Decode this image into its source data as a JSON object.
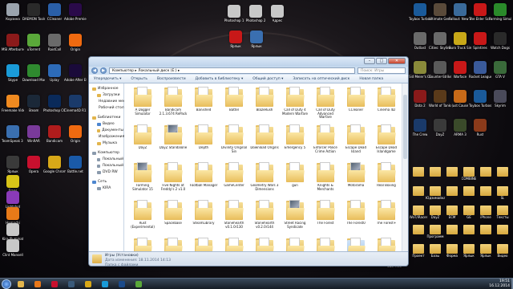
{
  "desktop": {
    "left_icons": [
      {
        "label": "Корзина",
        "color": "#9aa3ad",
        "icon": "recycle-bin-icon"
      },
      {
        "label": "MSI Afterburner",
        "color": "#8b1a1a",
        "icon": "afterburner-icon"
      },
      {
        "label": "Skype",
        "color": "#1a9bd8",
        "icon": "skype-icon"
      },
      {
        "label": "Freemake Video Conv...",
        "color": "#f08a20",
        "icon": "freemake-icon"
      },
      {
        "label": "TeamSpeak 3 Client",
        "color": "#3a6fb0",
        "icon": "teamspeak-icon"
      },
      {
        "label": "Ярлык",
        "color": "#3a3a3a",
        "icon": "shortcut-icon"
      },
      {
        "label": "DAEMON Tools Ultra",
        "color": "#2a2a2a",
        "icon": "daemon-tools-icon"
      },
      {
        "label": "uTorrent",
        "color": "#5aa83a",
        "icon": "utorrent-icon"
      },
      {
        "label": "Download Master",
        "color": "#2f8a2f",
        "icon": "download-master-icon"
      },
      {
        "label": "Steam",
        "color": "#1b2838",
        "icon": "steam-icon"
      },
      {
        "label": "WinRAR",
        "color": "#7a3a9a",
        "icon": "winrar-icon"
      },
      {
        "label": "Opera",
        "color": "#c8102e",
        "icon": "opera-icon"
      },
      {
        "label": "CCleaner",
        "color": "#2a5fa8",
        "icon": "ccleaner-icon"
      },
      {
        "label": "RaidCall",
        "color": "#6a6a6a",
        "icon": "raidcall-icon"
      },
      {
        "label": "Uplay",
        "color": "#2d6bb8",
        "icon": "uplay-icon"
      },
      {
        "label": "Photoshop CC x64",
        "color": "#0a2a5a",
        "icon": "photoshop-icon"
      },
      {
        "label": "Bandicam",
        "color": "#b01c1c",
        "icon": "bandicam-icon"
      },
      {
        "label": "Google Chrome",
        "color": "#d8a818",
        "icon": "chrome-icon"
      },
      {
        "label": "Adobe Premiere CC x64",
        "color": "#2a0a4a",
        "icon": "premiere-icon"
      },
      {
        "label": "Origin",
        "color": "#f06a10",
        "icon": "origin-icon"
      },
      {
        "label": "Adobe After Effects CC",
        "color": "#1a0a3a",
        "icon": "after-effects-icon"
      },
      {
        "label": "Cinema4D R15",
        "color": "#1a3a6a",
        "icon": "cinema4d-icon"
      },
      {
        "label": "Origin",
        "color": "#f06a10",
        "icon": "origin-icon"
      },
      {
        "label": "Battle.net",
        "color": "#1a5aa8",
        "icon": "battlenet-icon"
      },
      {
        "label": "Fraps",
        "color": "#d8c418",
        "icon": "fraps-icon"
      },
      {
        "label": "Lightshot",
        "color": "#8a3ab8",
        "icon": "lightshot-icon"
      },
      {
        "label": "Hamachi",
        "color": "#e87a18",
        "icon": "hamachi-icon"
      },
      {
        "label": "Kira Illuminat",
        "color": "#c8c8c8",
        "icon": "file-icon"
      },
      {
        "label": "Clint Mansell",
        "color": "#c8c8c8",
        "icon": "file-icon"
      }
    ],
    "top_icons": [
      {
        "label": "Photoshop 1",
        "color": "#c8c8c8"
      },
      {
        "label": "Photoshop 2",
        "color": "#c8c8c8"
      },
      {
        "label": "Адрес",
        "color": "#c8c8c8"
      },
      {
        "label": "Ярлык",
        "color": "#c81818"
      },
      {
        "label": "Ярлык",
        "color": "#3a6fb0"
      }
    ],
    "right_icons": [
      {
        "label": "Toybox Turbos",
        "color": "#1a5a9a"
      },
      {
        "label": "Ultimate General",
        "color": "#5a4a3a"
      },
      {
        "label": "Fallout: New Vegas",
        "color": "#3a6a9a"
      },
      {
        "label": "The Elder Scrolls",
        "color": "#c81818"
      },
      {
        "label": "Farming Simulator",
        "color": "#2a8a2a"
      },
      {
        "label": "Outlast",
        "color": "#6a6a6a"
      },
      {
        "label": "Cities: Skylines",
        "color": "#6a6a6a"
      },
      {
        "label": "Euro Truck Simulator",
        "color": "#c8a818"
      },
      {
        "label": "Spintires",
        "color": "#c81818"
      },
      {
        "label": "Watch Dogs",
        "color": "#2a2a2a"
      },
      {
        "label": "Sid Meier's Civ",
        "color": "#8a8a3a"
      },
      {
        "label": "Counter-Strike",
        "color": "#5a5a5a"
      },
      {
        "label": "Warface",
        "color": "#c81818"
      },
      {
        "label": "Rocket League",
        "color": "#3a5a9a"
      },
      {
        "label": "GTA V",
        "color": "#3a6a3a"
      },
      {
        "label": "Dota 2",
        "color": "#8a1a1a"
      },
      {
        "label": "World of Tanks",
        "color": "#5a3a1a"
      },
      {
        "label": "Just Cause",
        "color": "#c86a18"
      },
      {
        "label": "Toybox Turbos",
        "color": "#1a5a9a"
      },
      {
        "label": "Skyrim",
        "color": "#4a4a5a"
      },
      {
        "label": "The Crew",
        "color": "#1a3a6a"
      },
      {
        "label": "DayZ",
        "color": "#3a3a3a"
      },
      {
        "label": "ARMA 3",
        "color": "#3a4a2a"
      },
      {
        "label": "Rust",
        "color": "#8a3a1a"
      }
    ],
    "right_folders": [
      "",
      "",
      "",
      "COMBINE",
      "",
      "",
      "",
      "Юдзимайка",
      "",
      "",
      "",
      "SL",
      "WoT/iRacer",
      "DayZ",
      "ECM",
      "GE",
      "iPhone",
      "Тексты",
      "",
      "Программ",
      "",
      "",
      "",
      "",
      "Проект",
      "Базы",
      "Форма",
      "Ярлык",
      "Ярлык",
      "Видео"
    ],
    "bottom_right_text": [
      "Lo Jeunie",
      "Size Free"
    ]
  },
  "window": {
    "address": "Компьютер ▸ Локальный диск (E:) ▸",
    "search_placeholder": "Поиск: Игры",
    "toolbar": [
      "Упорядочить ▾",
      "Открыть",
      "Воспроизвести",
      "Добавить в библиотеку ▾",
      "Общий доступ ▾",
      "Записать на оптический диск",
      "Новая папка"
    ],
    "nav": [
      {
        "label": "Избранное",
        "kind": "star",
        "sub": false,
        "gap": false
      },
      {
        "label": "Загрузки",
        "kind": "folder",
        "sub": true,
        "gap": false
      },
      {
        "label": "Недавние места",
        "kind": "folder",
        "sub": true,
        "gap": false
      },
      {
        "label": "Рабочий стол",
        "kind": "blue",
        "sub": true,
        "gap": false
      },
      {
        "label": "Библиотеки",
        "kind": "folder",
        "sub": false,
        "gap": true
      },
      {
        "label": "Видео",
        "kind": "blue",
        "sub": true,
        "gap": false
      },
      {
        "label": "Документы",
        "kind": "folder",
        "sub": true,
        "gap": false
      },
      {
        "label": "Изображения",
        "kind": "blue",
        "sub": true,
        "gap": false
      },
      {
        "label": "Музыка",
        "kind": "folder",
        "sub": true,
        "gap": false
      },
      {
        "label": "Компьютер",
        "kind": "drive",
        "sub": false,
        "gap": true
      },
      {
        "label": "Локальный",
        "kind": "drive",
        "sub": true,
        "gap": false
      },
      {
        "label": "Локальный",
        "kind": "drive",
        "sub": true,
        "gap": false
      },
      {
        "label": "DVD RW",
        "kind": "drive",
        "sub": true,
        "gap": false
      },
      {
        "label": "Сеть",
        "kind": "blue",
        "sub": false,
        "gap": true
      },
      {
        "label": "KIRA",
        "kind": "drive",
        "sub": true,
        "gap": false
      }
    ],
    "items": [
      {
        "name": "A Dogger Simulator",
        "paper": "doc"
      },
      {
        "name": "Bandicam 2.1.3.674 RePack",
        "paper": "doc"
      },
      {
        "name": "Banished",
        "paper": "doc"
      },
      {
        "name": "Battel",
        "paper": "doc"
      },
      {
        "name": "BlazeRush",
        "paper": "doc"
      },
      {
        "name": "Call of Duty 4 Modern Warfare",
        "paper": "doc"
      },
      {
        "name": "Call of Duty Advanced Warfare",
        "paper": "doc"
      },
      {
        "name": "CCleaner",
        "paper": "doc"
      },
      {
        "name": "Cinema 4D",
        "paper": "doc"
      },
      {
        "name": "DayZ",
        "paper": "doc"
      },
      {
        "name": "DayZ Standalone",
        "paper": "img"
      },
      {
        "name": "Depth",
        "paper": "doc"
      },
      {
        "name": "Divinity Original Sin",
        "paper": "doc"
      },
      {
        "name": "Download Origins",
        "paper": "doc"
      },
      {
        "name": "Emergency 5",
        "paper": "doc"
      },
      {
        "name": "Enforcer Police Crime Action",
        "paper": "doc"
      },
      {
        "name": "Escape Dead Island",
        "paper": "doc"
      },
      {
        "name": "Escape Dead Islandgame",
        "paper": "doc"
      },
      {
        "name": "Farming Simulator 15",
        "paper": "img"
      },
      {
        "name": "Five Nights at Freddy's 2 v1.0",
        "paper": "doc"
      },
      {
        "name": "Football Manager",
        "paper": "doc"
      },
      {
        "name": "GameCenter",
        "paper": "doc"
      },
      {
        "name": "Geometry Wars 3 Dimensions",
        "paper": "doc"
      },
      {
        "name": "gun",
        "paper": "doc"
      },
      {
        "name": "Knights & Merchants",
        "paper": "doc"
      },
      {
        "name": "Motorama",
        "paper": "img"
      },
      {
        "name": "Real Boxing",
        "paper": "doc"
      },
      {
        "name": "Rust (Experimental)",
        "paper": "doc"
      },
      {
        "name": "Spacebase",
        "paper": "doc"
      },
      {
        "name": "SteamLibrary",
        "paper": "doc"
      },
      {
        "name": "Stonehearth v0.1.0r130",
        "paper": "doc"
      },
      {
        "name": "Stonehearth v0.2.0r144",
        "paper": "doc"
      },
      {
        "name": "Street Racing Syndicate",
        "paper": "img"
      },
      {
        "name": "The Forest",
        "paper": "doc"
      },
      {
        "name": "The Forest0",
        "paper": "doc"
      },
      {
        "name": "The Forest+",
        "paper": "doc"
      },
      {
        "name": "",
        "paper": "doc"
      },
      {
        "name": "",
        "paper": "doc"
      },
      {
        "name": "",
        "paper": "doc"
      },
      {
        "name": "",
        "paper": "doc"
      },
      {
        "name": "",
        "paper": "doc"
      },
      {
        "name": "",
        "paper": "doc"
      },
      {
        "name": "",
        "paper": "doc"
      },
      {
        "name": "",
        "paper": "doc",
        "selected": true
      },
      {
        "name": "",
        "paper": "doc"
      }
    ],
    "status": {
      "name": "Игры (Установки)",
      "modified": "Дата изменения: 18.11.2014 14:13",
      "type": "Папка с файлами"
    }
  },
  "taskbar": {
    "apps": [
      {
        "icon": "explorer-icon",
        "color": "#e2b54d"
      },
      {
        "icon": "media-player-icon",
        "color": "#e8781a"
      },
      {
        "icon": "opera-icon",
        "color": "#c8102e"
      },
      {
        "icon": "steam-icon",
        "color": "#3a5a7a"
      },
      {
        "icon": "chrome-icon",
        "color": "#d8a818"
      },
      {
        "icon": "skype-icon",
        "color": "#1a9bd8"
      },
      {
        "icon": "photoshop-icon",
        "color": "#1a4a8a"
      },
      {
        "icon": "utorrent-icon",
        "color": "#5aa83a"
      }
    ],
    "time": "19:51",
    "date": "16.12.2014"
  }
}
